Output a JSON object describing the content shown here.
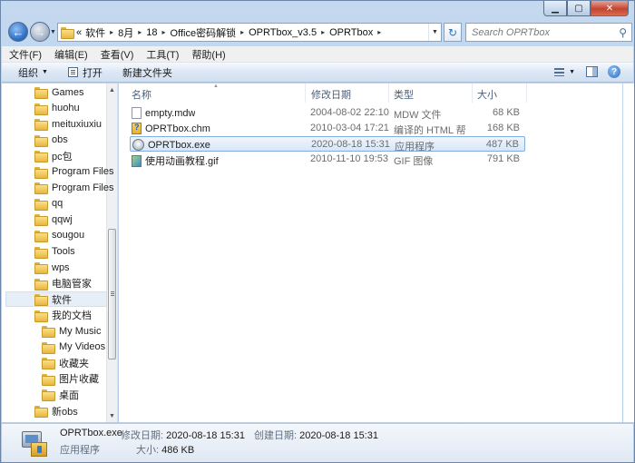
{
  "address": {
    "overflow": "«",
    "crumbs": [
      "软件",
      "8月",
      "18",
      "Office密码解锁",
      "OPRTbox_v3.5",
      "OPRTbox"
    ]
  },
  "search": {
    "placeholder": "Search OPRTbox"
  },
  "menu": [
    "文件(F)",
    "编辑(E)",
    "查看(V)",
    "工具(T)",
    "帮助(H)"
  ],
  "toolbar": {
    "organize": "组织",
    "open": "打开",
    "new_folder": "新建文件夹"
  },
  "nav": {
    "items": [
      {
        "label": "Games",
        "indent": 0
      },
      {
        "label": "huohu",
        "indent": 0
      },
      {
        "label": "meituxiuxiu",
        "indent": 0
      },
      {
        "label": "obs",
        "indent": 0
      },
      {
        "label": "pc包",
        "indent": 0
      },
      {
        "label": "Program Files",
        "indent": 0
      },
      {
        "label": "Program Files",
        "indent": 0
      },
      {
        "label": "qq",
        "indent": 0
      },
      {
        "label": "qqwj",
        "indent": 0
      },
      {
        "label": "sougou",
        "indent": 0
      },
      {
        "label": "Tools",
        "indent": 0
      },
      {
        "label": "wps",
        "indent": 0
      },
      {
        "label": "电脑管家",
        "indent": 0
      },
      {
        "label": "软件",
        "indent": 0,
        "selected": true
      },
      {
        "label": "我的文档",
        "indent": 0
      },
      {
        "label": "My Music",
        "indent": 1
      },
      {
        "label": "My Videos",
        "indent": 1
      },
      {
        "label": "收藏夹",
        "indent": 1
      },
      {
        "label": "图片收藏",
        "indent": 1
      },
      {
        "label": "桌面",
        "indent": 1
      },
      {
        "label": "新obs",
        "indent": 0
      }
    ]
  },
  "columns": {
    "name": "名称",
    "date": "修改日期",
    "type": "类型",
    "size": "大小"
  },
  "files": [
    {
      "name": "empty.mdw",
      "date": "2004-08-02 22:10",
      "type": "MDW 文件",
      "size": "68 KB",
      "icon": "document-icon"
    },
    {
      "name": "OPRTbox.chm",
      "date": "2010-03-04 17:21",
      "type": "编译的 HTML 帮...",
      "size": "168 KB",
      "icon": "help-file-icon"
    },
    {
      "name": "OPRTbox.exe",
      "date": "2020-08-18 15:31",
      "type": "应用程序",
      "size": "487 KB",
      "icon": "application-icon",
      "selected": true
    },
    {
      "name": "使用动画教程.gif",
      "date": "2010-11-10 19:53",
      "type": "GIF 图像",
      "size": "791 KB",
      "icon": "image-file-icon"
    }
  ],
  "details": {
    "name": "OPRTbox.exe",
    "type": "应用程序",
    "modified_label": "修改日期:",
    "modified": "2020-08-18 15:31",
    "created_label": "创建日期:",
    "created": "2020-08-18 15:31",
    "size_label": "大小:",
    "size": "486 KB"
  }
}
